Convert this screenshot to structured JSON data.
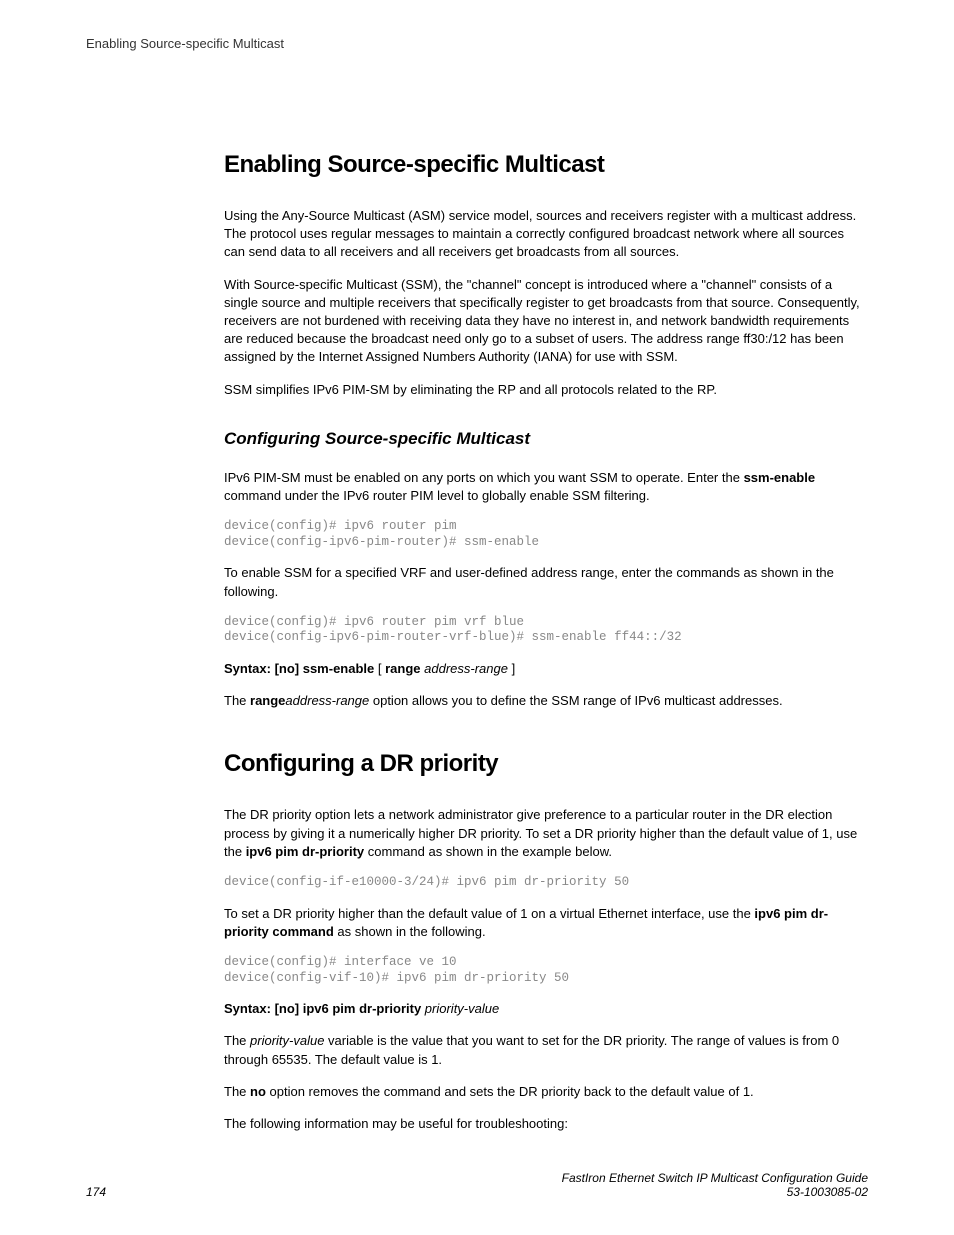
{
  "header": {
    "running_title": "Enabling Source-specific Multicast"
  },
  "section1": {
    "heading": "Enabling Source-specific Multicast",
    "p1": "Using the Any-Source Multicast (ASM) service model, sources and receivers register with a multicast address. The protocol uses regular messages to maintain a correctly configured broadcast network where all sources can send data to all receivers and all receivers get broadcasts from all sources.",
    "p2": "With Source-specific Multicast (SSM), the \"channel\" concept is introduced where a \"channel\" consists of a single source and multiple receivers that specifically register to get broadcasts from that source. Consequently, receivers are not burdened with receiving data they have no interest in, and network bandwidth requirements are reduced because the broadcast need only go to a subset of users. The address range ff30:/12 has been assigned by the Internet Assigned Numbers Authority (IANA) for use with SSM.",
    "p3": "SSM simplifies IPv6 PIM-SM by eliminating the RP and all protocols related to the RP."
  },
  "section1sub": {
    "heading": "Configuring Source-specific Multicast",
    "p1a": "IPv6 PIM-SM must be enabled on any ports on which you want SSM to operate. Enter the ",
    "p1b": "ssm-enable",
    "p1c": " command under the IPv6 router PIM level to globally enable SSM filtering.",
    "code1": "device(config)# ipv6 router pim\ndevice(config-ipv6-pim-router)# ssm-enable",
    "p2": "To enable SSM for a specified VRF and user-defined address range, enter the commands as shown in the following.",
    "code2": "device(config)# ipv6 router pim vrf blue\ndevice(config-ipv6-pim-router-vrf-blue)# ssm-enable ff44::/32",
    "syntax_label": "Syntax: [no] ssm-enable",
    "syntax_open": " [ ",
    "syntax_kw": "range",
    "syntax_sp": " ",
    "syntax_arg": "address-range",
    "syntax_close": " ]",
    "p3a": "The ",
    "p3b": "range",
    "p3c": "address-range",
    "p3d": " option allows you to define the SSM range of IPv6 multicast addresses."
  },
  "section2": {
    "heading": "Configuring a DR priority",
    "p1a": "The DR priority option lets a network administrator give preference to a particular router in the DR election process by giving it a numerically higher DR priority. To set a DR priority higher than the default value of 1, use the ",
    "p1b": "ipv6 pim dr-priority",
    "p1c": " command as shown in the example below.",
    "code1": "device(config-if-e10000-3/24)# ipv6 pim dr-priority 50",
    "p2a": "To set a DR priority higher than the default value of 1 on a virtual Ethernet interface, use the ",
    "p2b": "ipv6 pim dr-priority command",
    "p2c": " as shown in the following.",
    "code2": "device(config)# interface ve 10\ndevice(config-vif-10)# ipv6 pim dr-priority 50",
    "syntax_label": "Syntax: [no] ipv6 pim dr-priority",
    "syntax_arg": " priority-value",
    "p3a": "The ",
    "p3b": "priority-value",
    "p3c": " variable is the value that you want to set for the DR priority. The range of values is from 0 through 65535. The default value is 1.",
    "p4a": "The ",
    "p4b": "no",
    "p4c": " option removes the command and sets the DR priority back to the default value of 1.",
    "p5": "The following information may be useful for troubleshooting:"
  },
  "footer": {
    "page_number": "174",
    "doc_title": "FastIron Ethernet Switch IP Multicast Configuration Guide",
    "doc_id": "53-1003085-02"
  }
}
